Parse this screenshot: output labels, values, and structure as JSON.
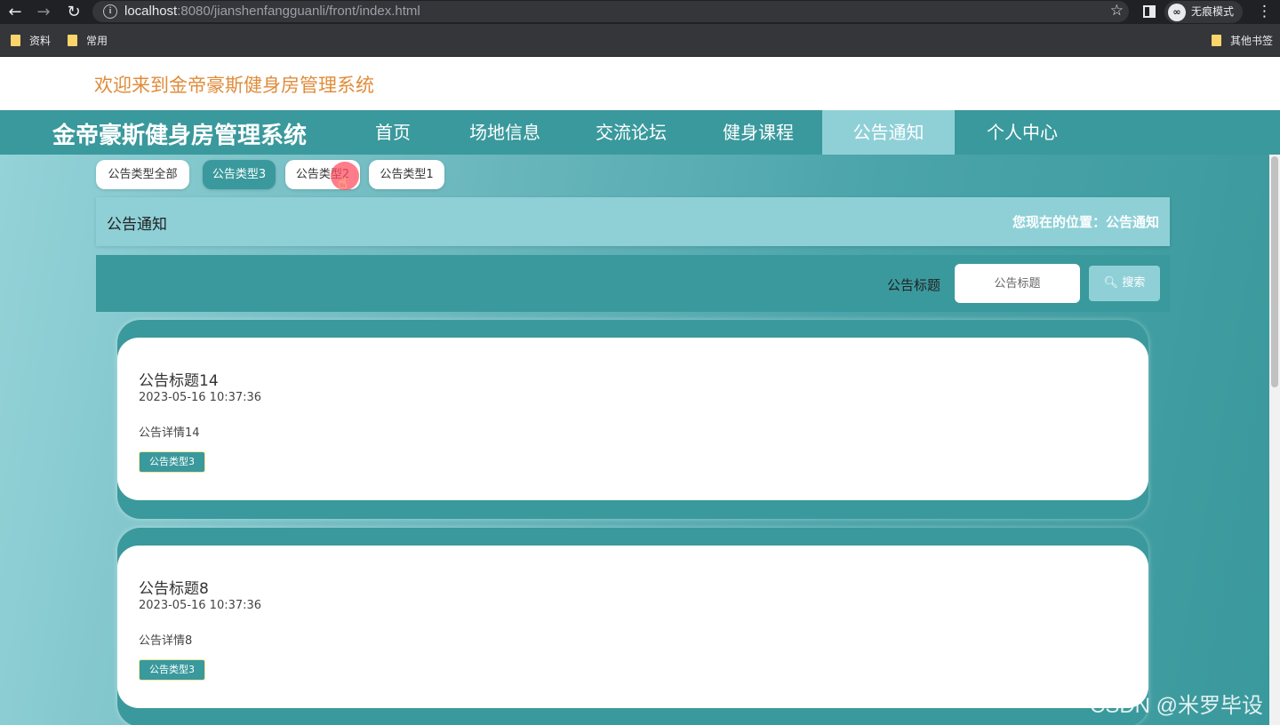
{
  "browser": {
    "url_host": "localhost",
    "url_path": ":8080/jianshenfangguanli/front/index.html",
    "incognito_label": "无痕模式",
    "bookmarks": [
      "资料",
      "常用"
    ],
    "other_bookmarks": "其他书签"
  },
  "header": {
    "welcome": "欢迎来到金帝豪斯健身房管理系统",
    "site_title": "金帝豪斯健身房管理系统",
    "nav": [
      "首页",
      "场地信息",
      "交流论坛",
      "健身课程",
      "公告通知",
      "个人中心"
    ],
    "active_nav": "公告通知"
  },
  "filters": {
    "types": [
      "公告类型全部",
      "公告类型3",
      "公告类型2",
      "公告类型1"
    ],
    "active": "公告类型3"
  },
  "breadcrumb": {
    "title": "公告通知",
    "location": "您现在的位置：公告通知"
  },
  "search": {
    "label": "公告标题",
    "placeholder": "公告标题",
    "button": "搜索"
  },
  "notices": [
    {
      "title": "公告标题14",
      "date": "2023-05-16 10:37:36",
      "desc": "公告详情14",
      "tag": "公告类型3"
    },
    {
      "title": "公告标题8",
      "date": "2023-05-16 10:37:36",
      "desc": "公告详情8",
      "tag": "公告类型3"
    }
  ],
  "watermark": "CSDN @米罗毕设",
  "colors": {
    "primary": "#3a999c",
    "light": "#8fd0d7",
    "welcome": "#e08c3a"
  }
}
